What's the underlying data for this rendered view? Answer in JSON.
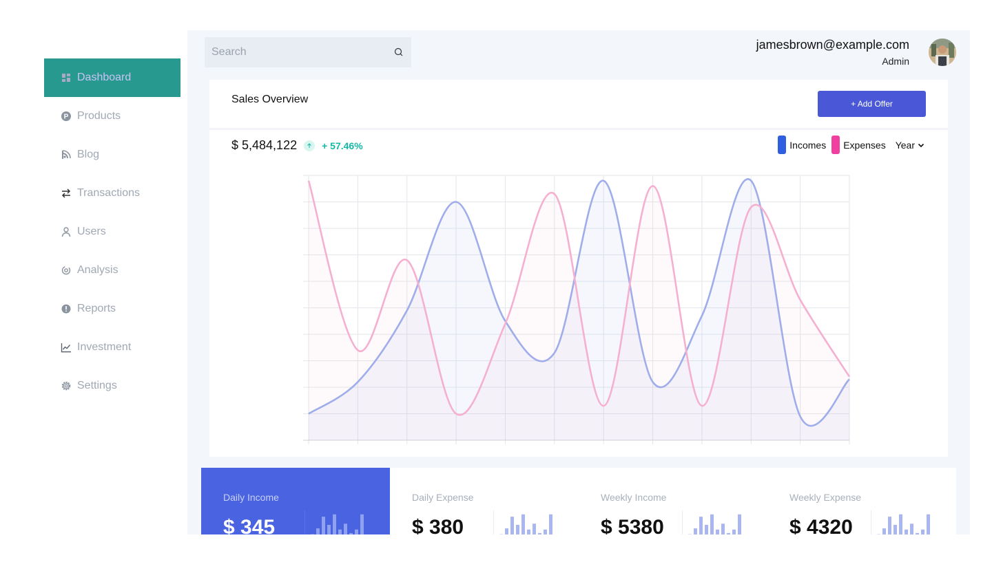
{
  "sidebar": {
    "items": [
      {
        "label": "Dashboard",
        "icon": "dashboard-icon"
      },
      {
        "label": "Products",
        "icon": "products-icon"
      },
      {
        "label": "Blog",
        "icon": "blog-icon"
      },
      {
        "label": "Transactions",
        "icon": "transactions-icon"
      },
      {
        "label": "Users",
        "icon": "user-icon"
      },
      {
        "label": "Analysis",
        "icon": "analysis-icon"
      },
      {
        "label": "Reports",
        "icon": "reports-icon"
      },
      {
        "label": "Investment",
        "icon": "investment-icon"
      },
      {
        "label": "Settings",
        "icon": "gear-icon"
      }
    ],
    "active": "Dashboard"
  },
  "header": {
    "search_placeholder": "Search",
    "user_email": "jamesbrown@example.com",
    "user_role": "Admin"
  },
  "sales": {
    "title": "Sales Overview",
    "add_button": "+ Add Offer",
    "total": "$ 5,484,122",
    "change": "+ 57.46%",
    "legend_incomes": "Incomes",
    "legend_expenses": "Expenses",
    "period": "Year"
  },
  "stats": [
    {
      "label": "Daily Income",
      "value": "$ 345"
    },
    {
      "label": "Daily Expense",
      "value": "$ 380"
    },
    {
      "label": "Weekly Income",
      "value": "$ 5380"
    },
    {
      "label": "Weekly Expense",
      "value": "$ 4320"
    }
  ],
  "colors": {
    "accent": "#27998f",
    "primary": "#4a58d8",
    "incomes": "#2f5fe0",
    "expenses": "#f03fa0",
    "incomes_line": "#9fadea",
    "expenses_line": "#f5b0d0"
  },
  "chart_data": {
    "type": "area",
    "x": [
      0,
      1,
      2,
      3,
      4,
      5,
      6,
      7,
      8,
      9,
      10,
      11
    ],
    "ylim": [
      0,
      10
    ],
    "grid": true,
    "series": [
      {
        "name": "Incomes",
        "values": [
          1.0,
          2.2,
          4.9,
          9.0,
          4.5,
          3.3,
          9.8,
          2.2,
          4.7,
          9.8,
          0.9,
          2.3
        ]
      },
      {
        "name": "Expenses",
        "values": [
          9.8,
          3.4,
          6.8,
          1.0,
          4.4,
          9.3,
          1.3,
          9.6,
          1.3,
          8.8,
          5.3,
          2.4
        ]
      }
    ],
    "sparkline": [
      0.1,
      0.35,
      0.85,
      0.5,
      0.95,
      0.3,
      0.55,
      0.15,
      0.3,
      0.95,
      0.05
    ]
  }
}
